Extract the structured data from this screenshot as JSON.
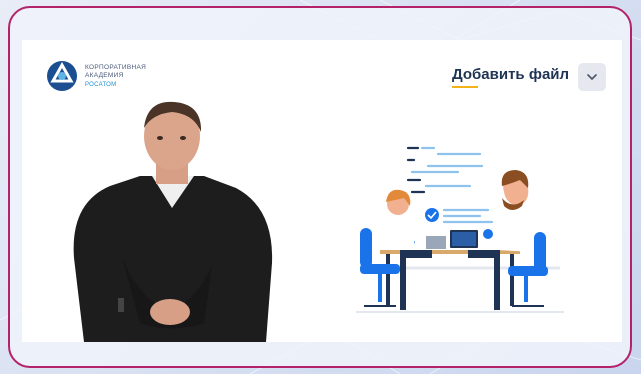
{
  "logo": {
    "line1": "КОРПОРАТИВНАЯ",
    "line2": "АКАДЕМИЯ",
    "line3": "РОСАТОМ"
  },
  "header": {
    "add_file_label": "Добавить файл",
    "dropdown_icon": "chevron-down-icon"
  },
  "colors": {
    "frame_border": "#b4226a",
    "accent_underline": "#f2b21a",
    "title_text": "#1f3354",
    "illustration_blue": "#1a73e8"
  }
}
